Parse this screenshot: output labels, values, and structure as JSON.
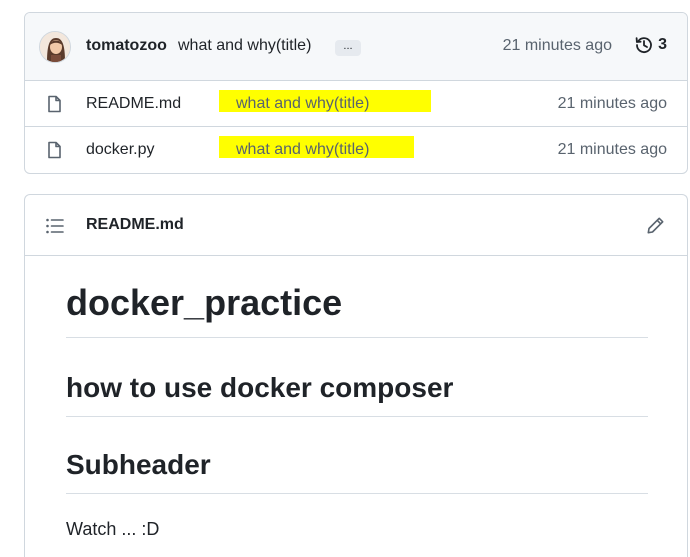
{
  "latest_commit": {
    "author": "tomatozoo",
    "message": "what and why(title)",
    "ellipsis": "...",
    "time": "21 minutes ago",
    "history_count": "3"
  },
  "files": [
    {
      "name": "README.md",
      "message": "what and why(title)",
      "time": "21 minutes ago",
      "icon": "file-icon"
    },
    {
      "name": "docker.py",
      "message": "what and why(title)",
      "time": "21 minutes ago",
      "icon": "file-icon"
    }
  ],
  "readme": {
    "title": "README.md",
    "h1": "docker_practice",
    "h2_1": "how to use docker composer",
    "h2_2": "Subheader",
    "paragraph": "Watch ... :D"
  },
  "colors": {
    "highlight": "#ffff00",
    "border": "#d0d7de",
    "header_bg": "#f6f8fa",
    "muted_text": "#59636e"
  }
}
